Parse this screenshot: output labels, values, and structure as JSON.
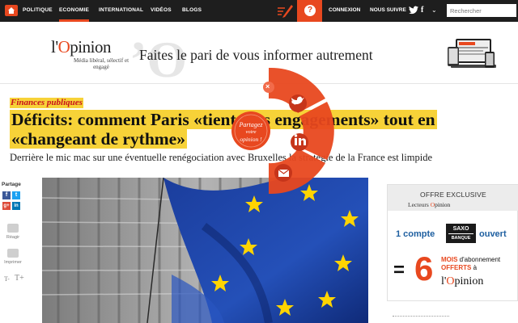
{
  "nav": {
    "items": [
      "POLITIQUE",
      "ECONOMIE",
      "INTERNATIONAL",
      "VIDÉOS",
      "BLOGS"
    ],
    "active": "ECONOMIE",
    "help_label": "?",
    "connexion": "CONNEXION",
    "follow": "NOUS SUIVRE",
    "facebook": "f",
    "more": "⌄",
    "search_placeholder": "Rechercher",
    "accent_color": "#e8481f"
  },
  "banner": {
    "logo_prefix": "l'",
    "logo_o": "O",
    "logo_rest": "pinion",
    "tagline": "Média libéral, sélectif et engagé",
    "slogan": "Faites le pari de vous informer autrement"
  },
  "article": {
    "kicker": "Finances publiques",
    "headline": "Déficits: comment Paris «tient» ses engagements» tout en «changeant de rythme»",
    "subtitle": "Derrière le mic mac sur une éventuelle renégociation avec Bruxelles la stratégie de la France est limpide"
  },
  "share_sidebar": {
    "label": "Partage",
    "facebook": "f",
    "twitter": "t",
    "google": "g+",
    "linkedin": "in",
    "react": "Réagir",
    "print": "Imprimer",
    "font_small": "T-",
    "font_big": "T+"
  },
  "share_wheel": {
    "center_line1": "Partagez",
    "center_line2": "votre",
    "center_line3": "opinion !",
    "close": "×",
    "color": "#e8481f"
  },
  "ad": {
    "offer": "OFFRE EXCLUSIVE",
    "readers_prefix": "Lecteurs ",
    "brand_o": "O",
    "brand_rest": "pinion",
    "compte": "1 compte",
    "saxo_line1": "SAXO",
    "saxo_line2": "BANQUE",
    "ouvert": "ouvert",
    "equals": "=",
    "six": "6",
    "mois": "MOIS",
    "abonnement": " d'abonnement",
    "offerts": "OFFERTS",
    "a": " à",
    "brand_prefix": "l'",
    "brand_o2": "O",
    "brand_rest2": "pinion"
  }
}
